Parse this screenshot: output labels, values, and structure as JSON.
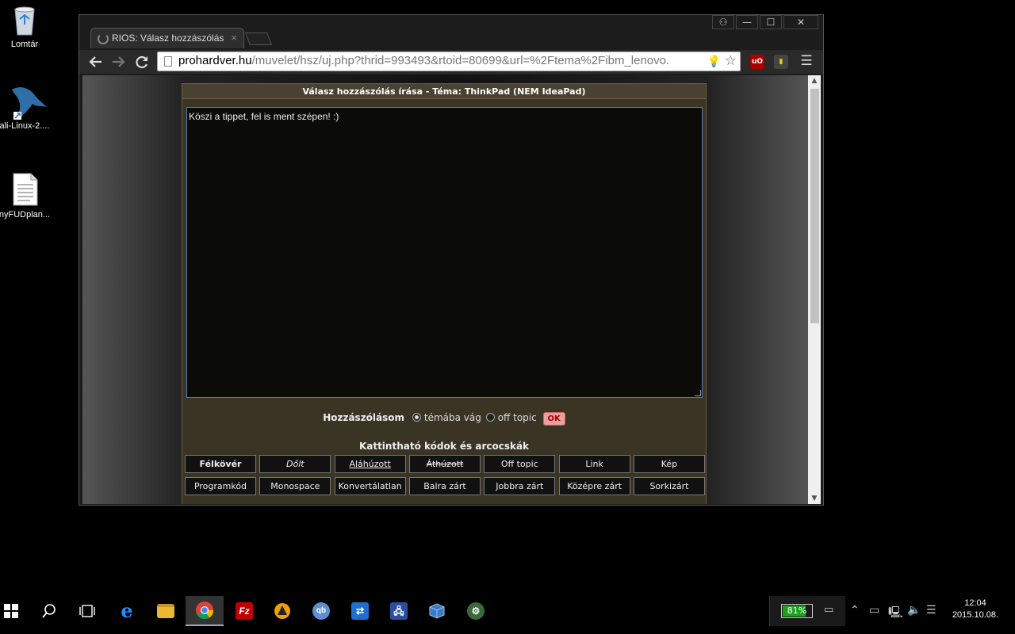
{
  "desktop": {
    "icons": [
      {
        "label": "Lomtár"
      },
      {
        "label": "ali-Linux-2...."
      },
      {
        "label": "nyFUDplan..."
      }
    ]
  },
  "browser": {
    "tab_title": "RIOS: Válasz hozzászólás",
    "url_host": "prohardver.hu",
    "url_path": "/muvelet/hsz/uj.php?thrid=993493&rtoid=80699&url=%2Ftema%2Fibm_lenovo."
  },
  "form": {
    "title": "Válasz hozzászólás írása - Téma: ThinkPad (NEM IdeaPad)",
    "reply_text": "Köszi a tippet, fel is ment szépen! :)",
    "post_type_label": "Hozzászólásom",
    "options": [
      {
        "label": "témába vág",
        "selected": true
      },
      {
        "label": "off topic",
        "selected": false
      }
    ],
    "ok_label": "OK",
    "codes_title": "Kattintható kódok és arcocskák",
    "code_buttons_row1": [
      "Félkövér",
      "Dőlt",
      "Aláhúzott",
      "Áthúzott",
      "Off topic",
      "Link",
      "Kép"
    ],
    "code_buttons_row2": [
      "Programkód",
      "Monospace",
      "Konvertálatlan",
      "Balra zárt",
      "Jobbra zárt",
      "Középre zárt",
      "Sorkizárt"
    ]
  },
  "taskbar": {
    "apps": [
      "start",
      "search",
      "task-view",
      "edge",
      "file-explorer",
      "chrome",
      "filezilla",
      "vlc",
      "qbittorrent",
      "teamviewer",
      "network-tool",
      "virtualbox",
      "security-tool"
    ],
    "active_app": "chrome",
    "battery_percent": "81%",
    "battery_level": 0.81,
    "clock_time": "12:04",
    "clock_date": "2015.10.08."
  },
  "colors": {
    "form_bg": "#3a3425",
    "textarea_border": "#4e7fc2",
    "ok_button": "#e8a0a0",
    "battery_fill": "#20a020"
  }
}
